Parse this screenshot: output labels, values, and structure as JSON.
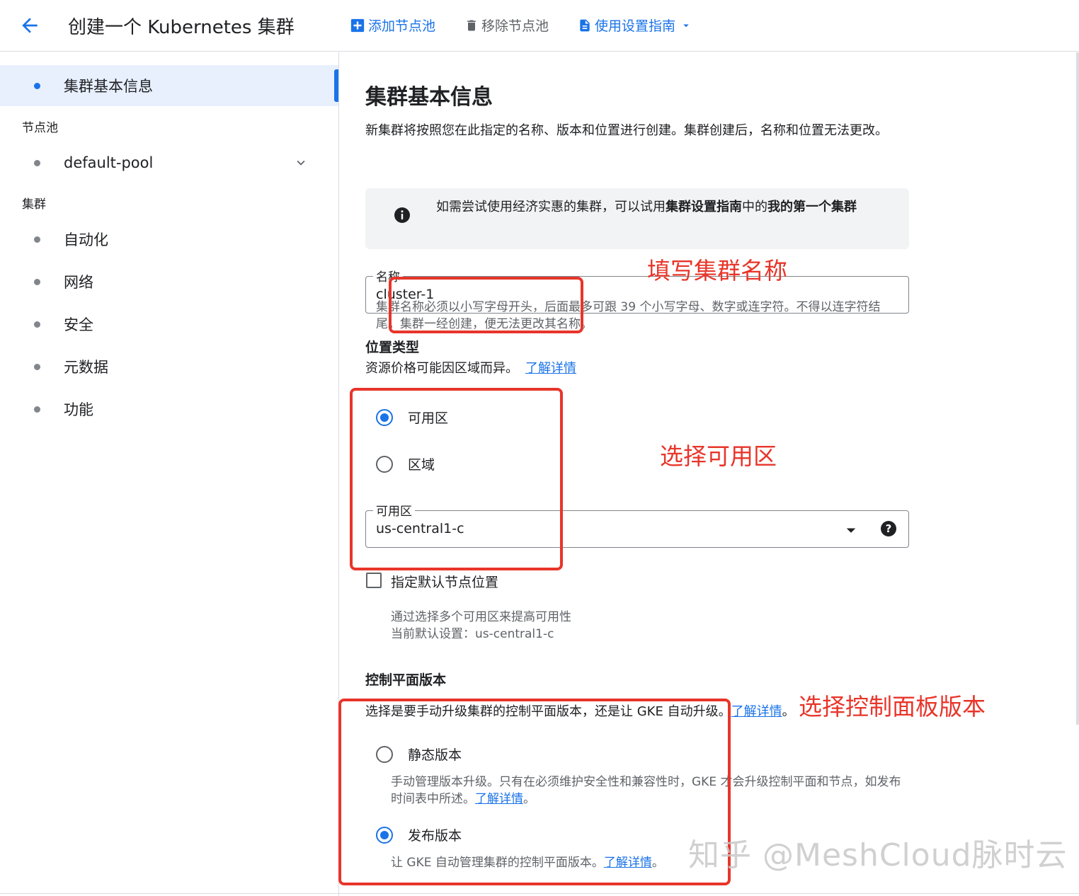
{
  "header": {
    "title": "创建一个 Kubernetes 集群",
    "add_node_pool": "添加节点池",
    "remove_node_pool": "移除节点池",
    "setup_guide": "使用设置指南"
  },
  "sidebar": {
    "active_item": "集群基本信息",
    "node_pools_section": "节点池",
    "node_pool_item": "default-pool",
    "cluster_section": "集群",
    "cluster_items": [
      "自动化",
      "网络",
      "安全",
      "元数据",
      "功能"
    ]
  },
  "main": {
    "heading": "集群基本信息",
    "description": "新集群将按照您在此指定的名称、版本和位置进行创建。集群创建后，名称和位置无法更改。",
    "info": {
      "prefix": "如需尝试使用经济实惠的集群，可以试用",
      "guide_name": "集群设置指南",
      "middle": "中的",
      "first_cluster": "我的第一个集群"
    },
    "name_field": {
      "label": "名称",
      "value": "cluster-1",
      "hint": "集群名称必须以小写字母开头，后面最多可跟 39 个小写字母、数字或连字符。不得以连字符结尾。集群一经创建，便无法更改其名称。"
    },
    "location_type": {
      "title": "位置类型",
      "subtitle": "资源价格可能因区域而异。",
      "learn_more": "了解详情",
      "options": [
        "可用区",
        "区域"
      ],
      "selected": "可用区"
    },
    "zone_field": {
      "label": "可用区",
      "value": "us-central1-c"
    },
    "default_node_locations": {
      "label": "指定默认节点位置",
      "hint_line1": "通过选择多个可用区来提高可用性",
      "hint_line2": "当前默认设置：us-central1-c"
    },
    "control_plane": {
      "title": "控制平面版本",
      "subtitle": "选择是要手动升级集群的控制平面版本，还是让 GKE 自动升级。",
      "learn_more": "了解详情",
      "static_label": "静态版本",
      "static_hint": "手动管理版本升级。只有在必须维护安全性和兼容性时，GKE 才会升级控制平面和节点，如发布时间表中所述。",
      "release_label": "发布版本",
      "release_hint": "让 GKE 自动管理集群的控制平面版本。",
      "selected": "发布版本"
    }
  },
  "annotations": {
    "name": "填写集群名称",
    "zone": "选择可用区",
    "control_plane": "选择控制面板版本"
  },
  "watermark": "知乎 @MeshCloud脉时云",
  "colors": {
    "accent": "#1a73e8",
    "annotation": "#e8352a"
  }
}
